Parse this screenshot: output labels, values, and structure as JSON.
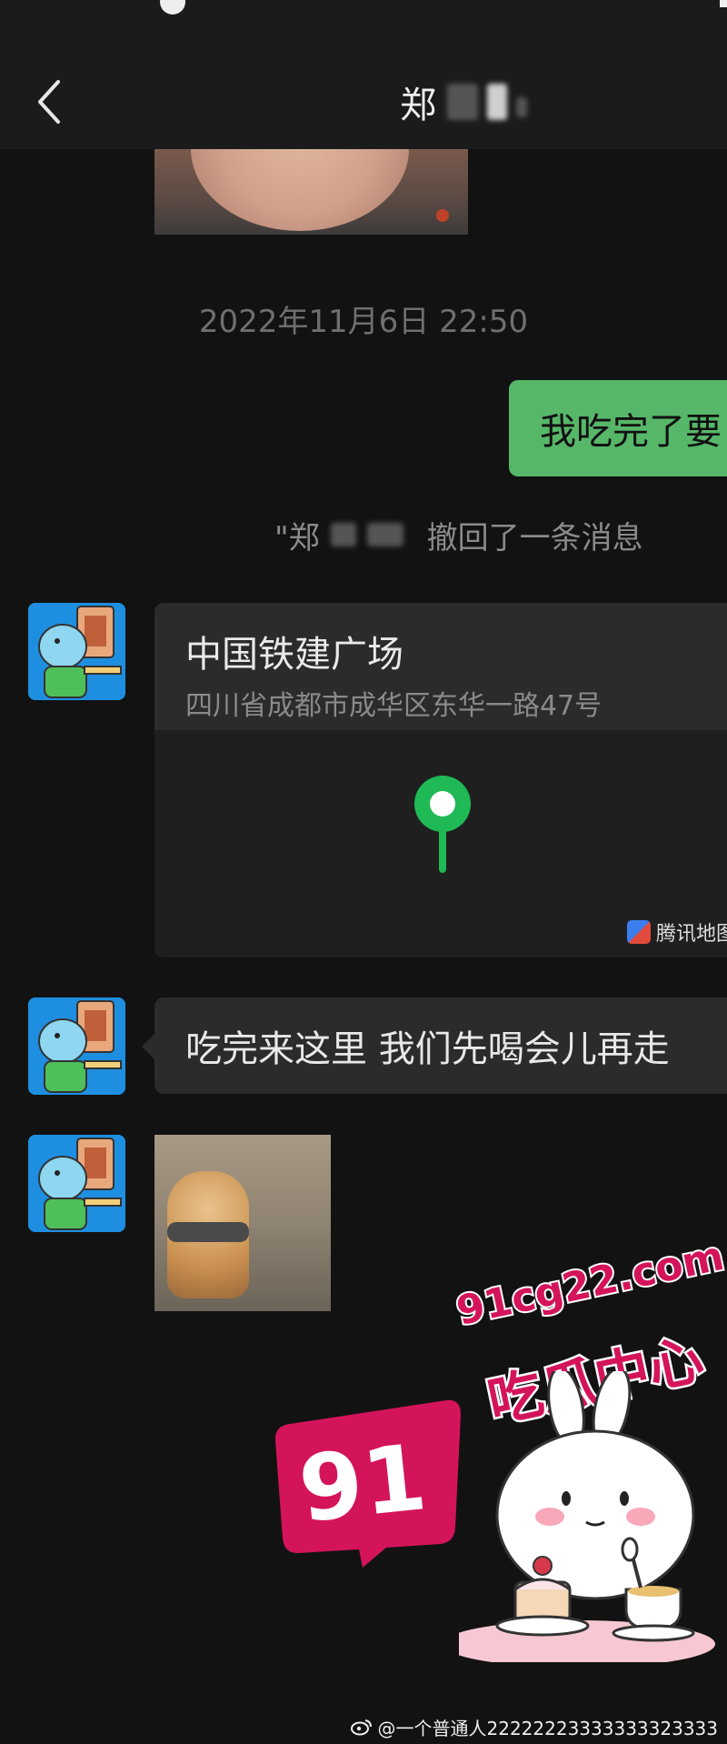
{
  "header": {
    "title": "郑"
  },
  "messages": {
    "timestamp": "2022年11月6日 22:50",
    "sent_text": "我吃完了要",
    "recall_quote": "\"郑",
    "recall_text": "撤回了一条消息",
    "location": {
      "title": "中国铁建广场",
      "address": "四川省成都市成华区东华一路47号",
      "map_brand": "腾讯地图"
    },
    "received_text": "吃完来这里 我们先喝会儿再走"
  },
  "watermark": {
    "number": "91",
    "url": "91cg22.com",
    "brand": "吃瓜中心"
  },
  "credit": {
    "text": "@一个普通人22222223333333323333"
  },
  "colors": {
    "background": "#121212",
    "sent_bubble": "#57b769",
    "received_bubble": "#2b2b2b",
    "pin": "#1fb955",
    "watermark": "#d4145a"
  },
  "icons": {
    "back": "chevron-left-icon",
    "pin": "map-pin-icon",
    "map_brand": "tencent-map-icon",
    "credit": "weibo-icon"
  }
}
